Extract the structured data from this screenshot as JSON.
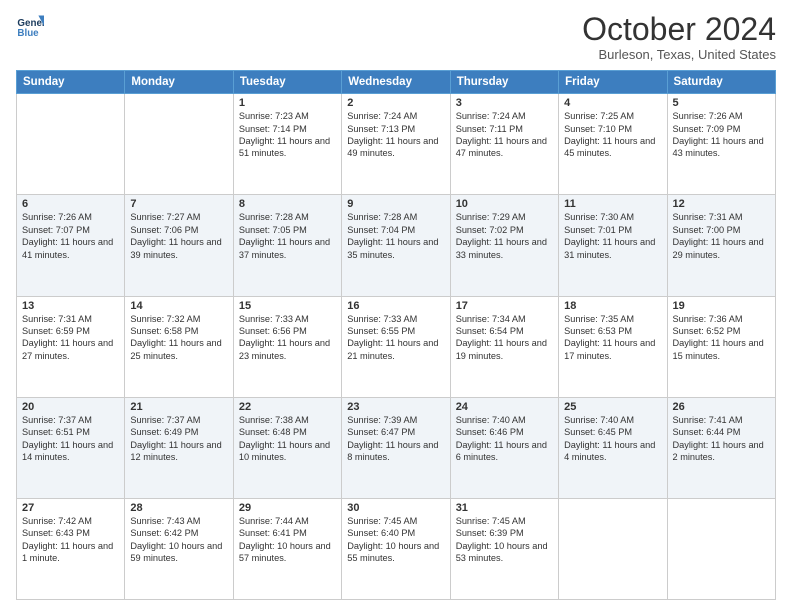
{
  "header": {
    "logo_line1": "General",
    "logo_line2": "Blue",
    "title": "October 2024",
    "subtitle": "Burleson, Texas, United States"
  },
  "days_of_week": [
    "Sunday",
    "Monday",
    "Tuesday",
    "Wednesday",
    "Thursday",
    "Friday",
    "Saturday"
  ],
  "weeks": [
    [
      {
        "day": "",
        "sunrise": "",
        "sunset": "",
        "daylight": ""
      },
      {
        "day": "",
        "sunrise": "",
        "sunset": "",
        "daylight": ""
      },
      {
        "day": "1",
        "sunrise": "Sunrise: 7:23 AM",
        "sunset": "Sunset: 7:14 PM",
        "daylight": "Daylight: 11 hours and 51 minutes."
      },
      {
        "day": "2",
        "sunrise": "Sunrise: 7:24 AM",
        "sunset": "Sunset: 7:13 PM",
        "daylight": "Daylight: 11 hours and 49 minutes."
      },
      {
        "day": "3",
        "sunrise": "Sunrise: 7:24 AM",
        "sunset": "Sunset: 7:11 PM",
        "daylight": "Daylight: 11 hours and 47 minutes."
      },
      {
        "day": "4",
        "sunrise": "Sunrise: 7:25 AM",
        "sunset": "Sunset: 7:10 PM",
        "daylight": "Daylight: 11 hours and 45 minutes."
      },
      {
        "day": "5",
        "sunrise": "Sunrise: 7:26 AM",
        "sunset": "Sunset: 7:09 PM",
        "daylight": "Daylight: 11 hours and 43 minutes."
      }
    ],
    [
      {
        "day": "6",
        "sunrise": "Sunrise: 7:26 AM",
        "sunset": "Sunset: 7:07 PM",
        "daylight": "Daylight: 11 hours and 41 minutes."
      },
      {
        "day": "7",
        "sunrise": "Sunrise: 7:27 AM",
        "sunset": "Sunset: 7:06 PM",
        "daylight": "Daylight: 11 hours and 39 minutes."
      },
      {
        "day": "8",
        "sunrise": "Sunrise: 7:28 AM",
        "sunset": "Sunset: 7:05 PM",
        "daylight": "Daylight: 11 hours and 37 minutes."
      },
      {
        "day": "9",
        "sunrise": "Sunrise: 7:28 AM",
        "sunset": "Sunset: 7:04 PM",
        "daylight": "Daylight: 11 hours and 35 minutes."
      },
      {
        "day": "10",
        "sunrise": "Sunrise: 7:29 AM",
        "sunset": "Sunset: 7:02 PM",
        "daylight": "Daylight: 11 hours and 33 minutes."
      },
      {
        "day": "11",
        "sunrise": "Sunrise: 7:30 AM",
        "sunset": "Sunset: 7:01 PM",
        "daylight": "Daylight: 11 hours and 31 minutes."
      },
      {
        "day": "12",
        "sunrise": "Sunrise: 7:31 AM",
        "sunset": "Sunset: 7:00 PM",
        "daylight": "Daylight: 11 hours and 29 minutes."
      }
    ],
    [
      {
        "day": "13",
        "sunrise": "Sunrise: 7:31 AM",
        "sunset": "Sunset: 6:59 PM",
        "daylight": "Daylight: 11 hours and 27 minutes."
      },
      {
        "day": "14",
        "sunrise": "Sunrise: 7:32 AM",
        "sunset": "Sunset: 6:58 PM",
        "daylight": "Daylight: 11 hours and 25 minutes."
      },
      {
        "day": "15",
        "sunrise": "Sunrise: 7:33 AM",
        "sunset": "Sunset: 6:56 PM",
        "daylight": "Daylight: 11 hours and 23 minutes."
      },
      {
        "day": "16",
        "sunrise": "Sunrise: 7:33 AM",
        "sunset": "Sunset: 6:55 PM",
        "daylight": "Daylight: 11 hours and 21 minutes."
      },
      {
        "day": "17",
        "sunrise": "Sunrise: 7:34 AM",
        "sunset": "Sunset: 6:54 PM",
        "daylight": "Daylight: 11 hours and 19 minutes."
      },
      {
        "day": "18",
        "sunrise": "Sunrise: 7:35 AM",
        "sunset": "Sunset: 6:53 PM",
        "daylight": "Daylight: 11 hours and 17 minutes."
      },
      {
        "day": "19",
        "sunrise": "Sunrise: 7:36 AM",
        "sunset": "Sunset: 6:52 PM",
        "daylight": "Daylight: 11 hours and 15 minutes."
      }
    ],
    [
      {
        "day": "20",
        "sunrise": "Sunrise: 7:37 AM",
        "sunset": "Sunset: 6:51 PM",
        "daylight": "Daylight: 11 hours and 14 minutes."
      },
      {
        "day": "21",
        "sunrise": "Sunrise: 7:37 AM",
        "sunset": "Sunset: 6:49 PM",
        "daylight": "Daylight: 11 hours and 12 minutes."
      },
      {
        "day": "22",
        "sunrise": "Sunrise: 7:38 AM",
        "sunset": "Sunset: 6:48 PM",
        "daylight": "Daylight: 11 hours and 10 minutes."
      },
      {
        "day": "23",
        "sunrise": "Sunrise: 7:39 AM",
        "sunset": "Sunset: 6:47 PM",
        "daylight": "Daylight: 11 hours and 8 minutes."
      },
      {
        "day": "24",
        "sunrise": "Sunrise: 7:40 AM",
        "sunset": "Sunset: 6:46 PM",
        "daylight": "Daylight: 11 hours and 6 minutes."
      },
      {
        "day": "25",
        "sunrise": "Sunrise: 7:40 AM",
        "sunset": "Sunset: 6:45 PM",
        "daylight": "Daylight: 11 hours and 4 minutes."
      },
      {
        "day": "26",
        "sunrise": "Sunrise: 7:41 AM",
        "sunset": "Sunset: 6:44 PM",
        "daylight": "Daylight: 11 hours and 2 minutes."
      }
    ],
    [
      {
        "day": "27",
        "sunrise": "Sunrise: 7:42 AM",
        "sunset": "Sunset: 6:43 PM",
        "daylight": "Daylight: 11 hours and 1 minute."
      },
      {
        "day": "28",
        "sunrise": "Sunrise: 7:43 AM",
        "sunset": "Sunset: 6:42 PM",
        "daylight": "Daylight: 10 hours and 59 minutes."
      },
      {
        "day": "29",
        "sunrise": "Sunrise: 7:44 AM",
        "sunset": "Sunset: 6:41 PM",
        "daylight": "Daylight: 10 hours and 57 minutes."
      },
      {
        "day": "30",
        "sunrise": "Sunrise: 7:45 AM",
        "sunset": "Sunset: 6:40 PM",
        "daylight": "Daylight: 10 hours and 55 minutes."
      },
      {
        "day": "31",
        "sunrise": "Sunrise: 7:45 AM",
        "sunset": "Sunset: 6:39 PM",
        "daylight": "Daylight: 10 hours and 53 minutes."
      },
      {
        "day": "",
        "sunrise": "",
        "sunset": "",
        "daylight": ""
      },
      {
        "day": "",
        "sunrise": "",
        "sunset": "",
        "daylight": ""
      }
    ]
  ]
}
